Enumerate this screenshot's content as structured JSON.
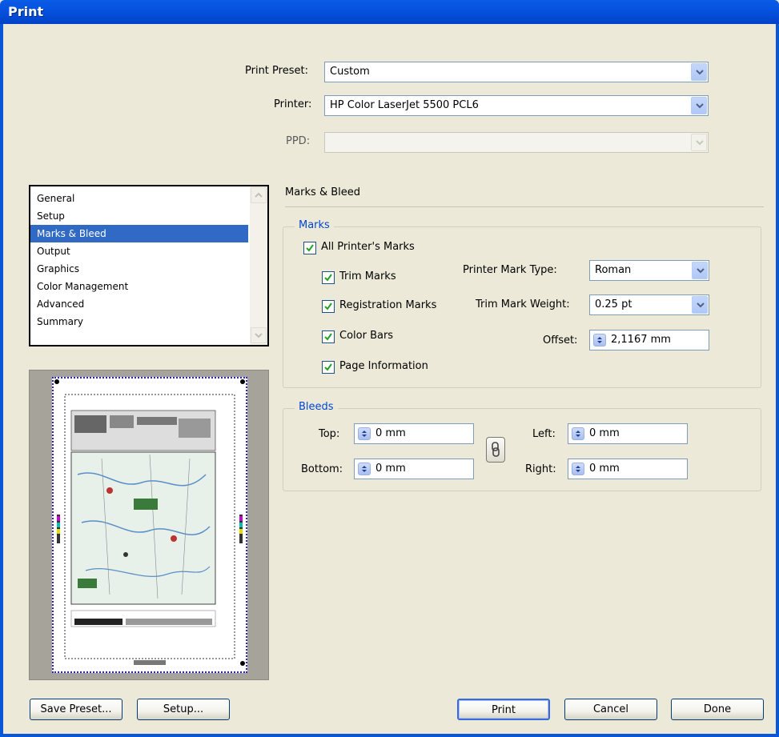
{
  "window": {
    "title": "Print"
  },
  "preset": {
    "label": "Print Preset:",
    "value": "Custom"
  },
  "printer": {
    "label": "Printer:",
    "value": "HP Color LaserJet 5500 PCL6"
  },
  "ppd": {
    "label": "PPD:",
    "value": ""
  },
  "categories": [
    "General",
    "Setup",
    "Marks & Bleed",
    "Output",
    "Graphics",
    "Color Management",
    "Advanced",
    "Summary"
  ],
  "selected_category": "Marks & Bleed",
  "section_title": "Marks & Bleed",
  "marks": {
    "legend": "Marks",
    "all_printers_marks": "All Printer's Marks",
    "trim_marks": "Trim Marks",
    "registration_marks": "Registration Marks",
    "color_bars": "Color Bars",
    "page_information": "Page Information",
    "mark_type_label": "Printer Mark Type:",
    "mark_type_value": "Roman",
    "trim_weight_label": "Trim Mark Weight:",
    "trim_weight_value": "0.25 pt",
    "offset_label": "Offset:",
    "offset_value": "2,1167 mm",
    "checked": {
      "all": true,
      "trim": true,
      "registration": true,
      "color_bars": true,
      "page_info": true
    }
  },
  "bleeds": {
    "legend": "Bleeds",
    "top_label": "Top:",
    "top_value": "0 mm",
    "bottom_label": "Bottom:",
    "bottom_value": "0 mm",
    "left_label": "Left:",
    "left_value": "0 mm",
    "right_label": "Right:",
    "right_value": "0 mm"
  },
  "buttons": {
    "save_preset": "Save Preset...",
    "setup": "Setup...",
    "print": "Print",
    "cancel": "Cancel",
    "done": "Done"
  },
  "icons": [
    "chevron-down-icon",
    "checkmark-icon",
    "spinner-icon",
    "chain-link-icon",
    "scroll-up-icon",
    "scroll-down-icon"
  ],
  "colors": {
    "titlebar": "#0653e0",
    "selection": "#316ac5",
    "legend": "#0046d5",
    "preview_border": "#2a22c8"
  }
}
